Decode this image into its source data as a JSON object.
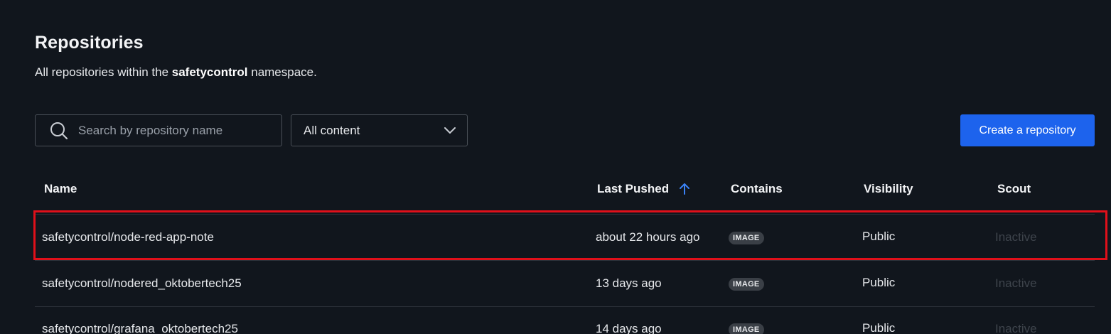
{
  "header": {
    "title": "Repositories",
    "subtitle_prefix": "All repositories within the ",
    "namespace": "safetycontrol",
    "subtitle_suffix": " namespace."
  },
  "toolbar": {
    "search_placeholder": "Search by repository name",
    "filter_value": "All content",
    "create_label": "Create a repository"
  },
  "table": {
    "columns": {
      "name": "Name",
      "last_pushed": "Last Pushed",
      "contains": "Contains",
      "visibility": "Visibility",
      "scout": "Scout"
    },
    "rows": [
      {
        "name": "safetycontrol/node-red-app-note",
        "last_pushed": "about 22 hours ago",
        "contains": "IMAGE",
        "visibility": "Public",
        "scout": "Inactive"
      },
      {
        "name": "safetycontrol/nodered_oktobertech25",
        "last_pushed": "13 days ago",
        "contains": "IMAGE",
        "visibility": "Public",
        "scout": "Inactive"
      },
      {
        "name": "safetycontrol/grafana_oktobertech25",
        "last_pushed": "14 days ago",
        "contains": "IMAGE",
        "visibility": "Public",
        "scout": "Inactive"
      }
    ]
  },
  "colors": {
    "background": "#11161d",
    "accent": "#1d63ed",
    "highlight": "#e0101a"
  },
  "icons": {
    "search": "search-icon",
    "dropdown": "chevron-down-icon",
    "sort": "arrow-up-icon"
  }
}
